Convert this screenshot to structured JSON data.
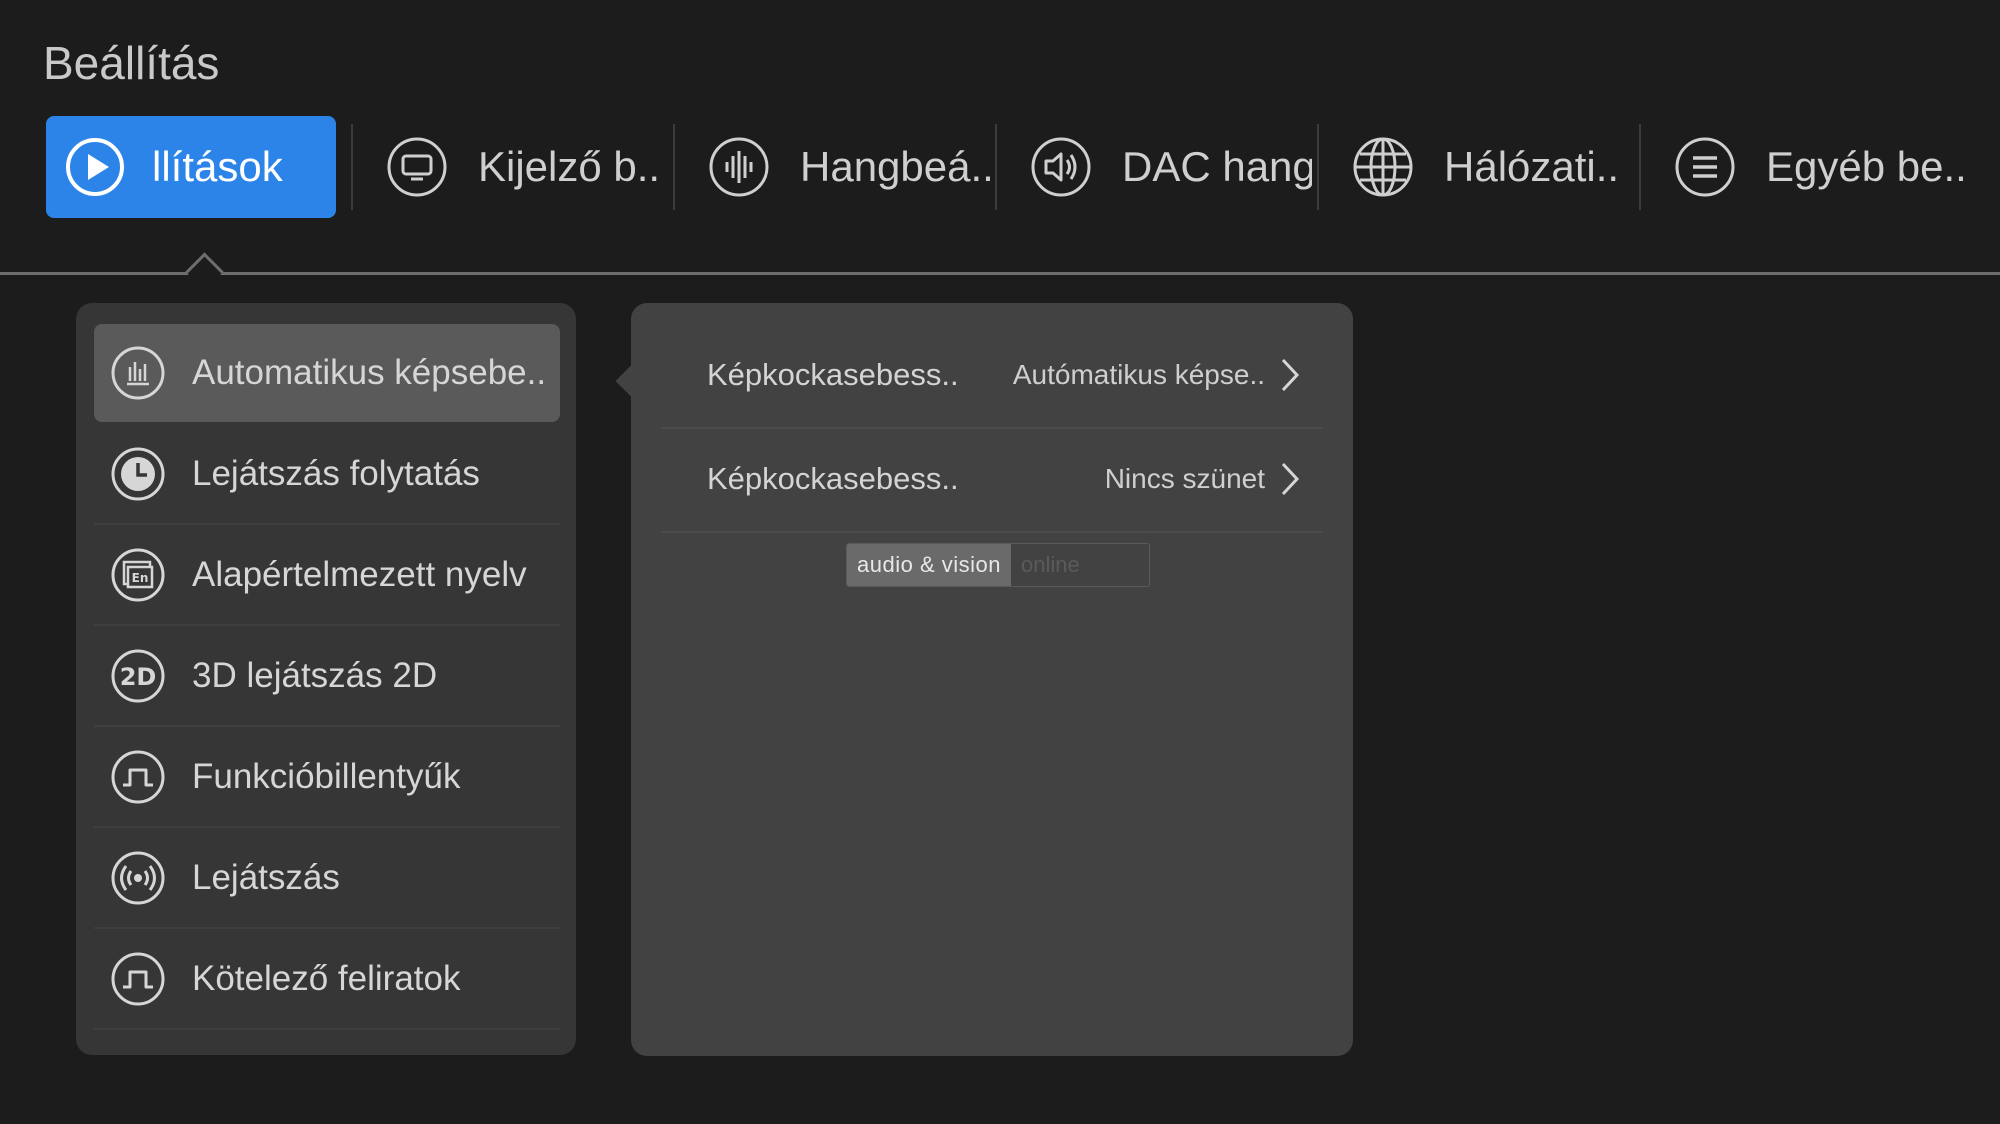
{
  "page": {
    "title": "Beállítás"
  },
  "tabs": [
    {
      "label": "llítások",
      "icon": "play-circle-icon",
      "active": true
    },
    {
      "label": "Kijelző b..",
      "icon": "monitor-icon",
      "active": false
    },
    {
      "label": "Hangbeá..",
      "icon": "sound-wave-icon",
      "active": false
    },
    {
      "label": "DAC hang",
      "icon": "speaker-icon",
      "active": false
    },
    {
      "label": "Hálózati..",
      "icon": "globe-icon",
      "active": false
    },
    {
      "label": "Egyéb be..",
      "icon": "menu-lines-icon",
      "active": false
    }
  ],
  "menu": {
    "items": [
      {
        "label": "Automatikus képsebe..",
        "icon": "bar-chart-icon",
        "selected": true
      },
      {
        "label": "Lejátszás folytatás",
        "icon": "clock-icon",
        "selected": false
      },
      {
        "label": "Alapértelmezett nyelv",
        "icon": "language-en-icon",
        "selected": false
      },
      {
        "label": "3D lejátszás 2D",
        "icon": "2d-icon",
        "selected": false
      },
      {
        "label": "Funkcióbillentyűk",
        "icon": "pulse-key-icon",
        "selected": false
      },
      {
        "label": "Lejátszás",
        "icon": "broadcast-icon",
        "selected": false
      },
      {
        "label": "Kötelező feliratok",
        "icon": "pulse-key-icon",
        "selected": false
      }
    ]
  },
  "detail": {
    "rows": [
      {
        "label": "Képkockasebess..",
        "value": "Autómatikus képse.."
      },
      {
        "label": "Képkockasebess..",
        "value": "Nincs szünet"
      }
    ]
  },
  "watermark": {
    "part1": "audio & vision",
    "part2": "online"
  },
  "colors": {
    "accent": "#2d84e8",
    "background": "#1c1c1c",
    "panel": "#363636",
    "detail_panel": "#424242"
  }
}
